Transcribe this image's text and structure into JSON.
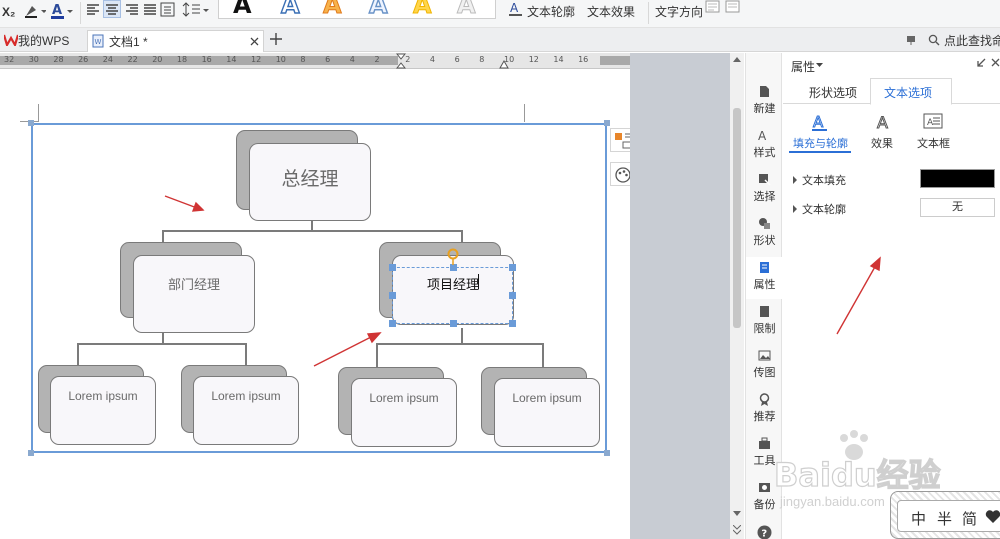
{
  "toolbar": {
    "subscript_label": "X₂",
    "text_outline_label": "文本轮廓",
    "text_effect_label": "文本效果",
    "text_direction_label": "文字方向",
    "style_glyph": "A"
  },
  "tabs": {
    "home": "我的WPS",
    "document": "文档1 *",
    "search_placeholder": "点此查找命令"
  },
  "ruler": {
    "ticks": [
      "32",
      "30",
      "28",
      "26",
      "24",
      "22",
      "20",
      "18",
      "16",
      "14",
      "12",
      "10",
      "8",
      "6",
      "4",
      "2",
      "2",
      "4",
      "6",
      "8",
      "10",
      "12",
      "14",
      "16"
    ]
  },
  "chart": {
    "top": "总经理",
    "mid_left": "部门经理",
    "mid_right": "项目经理",
    "leaf": "Lorem ipsum"
  },
  "strip": {
    "items": [
      "新建",
      "样式",
      "选择",
      "形状",
      "属性",
      "限制",
      "传图",
      "推荐",
      "工具",
      "备份"
    ]
  },
  "panel": {
    "title": "属性",
    "tab_shape": "形状选项",
    "tab_text": "文本选项",
    "sub_fill": "填充与轮廓",
    "sub_effect": "效果",
    "sub_textbox": "文本框",
    "fill_label": "文本填充",
    "outline_label": "文本轮廓",
    "outline_value": "无",
    "fill_color": "#000000"
  },
  "ime": {
    "items": [
      "中",
      "半",
      "简"
    ]
  },
  "watermark": {
    "text": "Baidu经验",
    "url": "jingyan.baidu.com"
  },
  "colors": {
    "accent": "#2b6fd6",
    "arrow": "#d03434",
    "selection": "#6a9bd8"
  }
}
